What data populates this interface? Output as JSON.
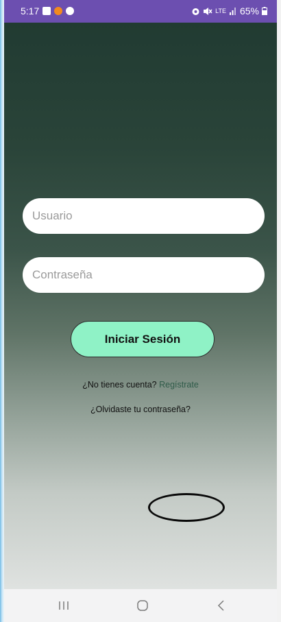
{
  "status_bar": {
    "time": "5:17",
    "network_label": "LTE",
    "battery_percent": "65%",
    "icons": [
      "gallery-icon",
      "recording-icon",
      "facebook-icon",
      "alarm-icon",
      "mute-icon",
      "signal-icon",
      "battery-icon"
    ],
    "background": "#6c4fb0"
  },
  "login": {
    "username_placeholder": "Usuario",
    "password_placeholder": "Contraseña",
    "submit_label": "Iniciar Sesión",
    "register_prompt": "¿No tienes cuenta?",
    "register_link": "Regístrate",
    "forgot_password": "¿Olvidaste tu contraseña?",
    "button_color": "#8ff2c6",
    "gradient_top": "#213b32",
    "gradient_bottom": "#dfe2e0"
  },
  "nav_bar": {
    "buttons": [
      "recent-apps-icon",
      "home-icon",
      "back-icon"
    ]
  }
}
